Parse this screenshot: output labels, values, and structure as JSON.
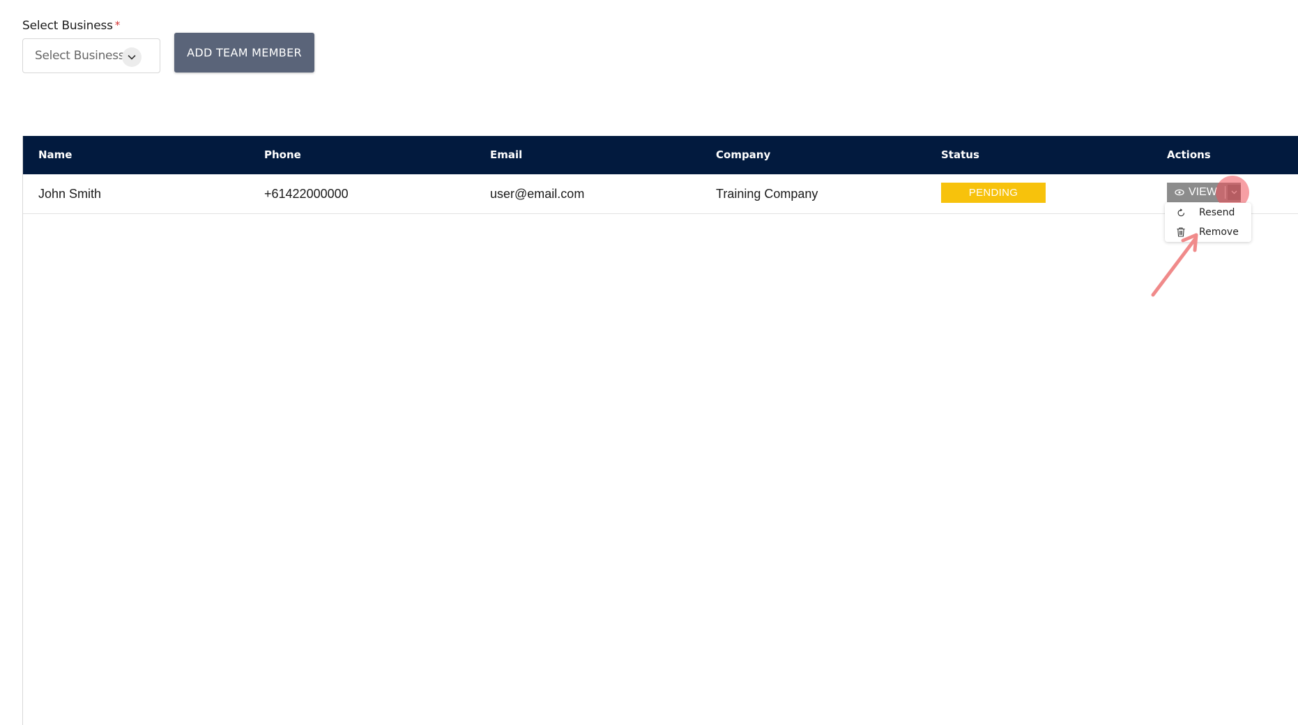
{
  "form": {
    "label": "Select Business",
    "required_mark": "*",
    "select_placeholder": "Select Business",
    "add_button_label": "ADD TEAM MEMBER"
  },
  "table": {
    "columns": [
      "Name",
      "Phone",
      "Email",
      "Company",
      "Status",
      "Actions"
    ],
    "rows": [
      {
        "name": "John Smith",
        "phone": "+61422000000",
        "email": "user@email.com",
        "company": "Training Company",
        "status": "PENDING"
      }
    ]
  },
  "actions": {
    "view_label": "VIEW",
    "menu": [
      {
        "label": "Resend",
        "icon": "refresh-icon"
      },
      {
        "label": "Remove",
        "icon": "trash-icon"
      }
    ]
  },
  "colors": {
    "header_bg": "#021a3e",
    "button_bg": "#5a6479",
    "status_pending": "#f7c20c",
    "annotation": "#f08080"
  }
}
